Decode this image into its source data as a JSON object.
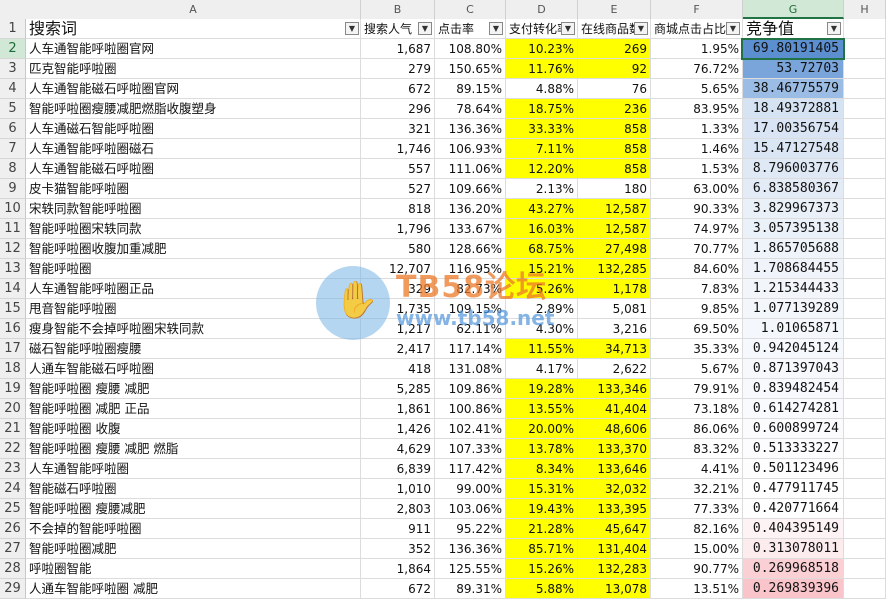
{
  "columns": [
    "A",
    "B",
    "C",
    "D",
    "E",
    "F",
    "G",
    "H"
  ],
  "header": {
    "row_number": "1",
    "keyword": "搜索词",
    "popularity": "搜索人气",
    "ctr": "点击率",
    "conversion": "支付转化率",
    "online_goods": "在线商品数",
    "mall_ctr": "商城点击占比",
    "competition": "竞争值"
  },
  "dropdown_glyph": "▼",
  "rows": [
    {
      "n": "2",
      "kw": "人车通智能呼啦圈官网",
      "pop": "1,687",
      "ctr": "108.80%",
      "conv": "10.23%",
      "goods": "269",
      "mall": "1.95%",
      "comp": "69.80191405",
      "hl": true
    },
    {
      "n": "3",
      "kw": "匹克智能呼啦圈",
      "pop": "279",
      "ctr": "150.65%",
      "conv": "11.76%",
      "goods": "92",
      "mall": "76.72%",
      "comp": "53.72703",
      "hl": true
    },
    {
      "n": "4",
      "kw": "人车通智能磁石呼啦圈官网",
      "pop": "672",
      "ctr": "89.15%",
      "conv": "4.88%",
      "goods": "76",
      "mall": "5.65%",
      "comp": "38.46775579",
      "hl": false
    },
    {
      "n": "5",
      "kw": "智能呼啦圈瘦腰减肥燃脂收腹塑身",
      "pop": "296",
      "ctr": "78.64%",
      "conv": "18.75%",
      "goods": "236",
      "mall": "83.95%",
      "comp": "18.49372881",
      "hl": true
    },
    {
      "n": "6",
      "kw": "人车通磁石智能呼啦圈",
      "pop": "321",
      "ctr": "136.36%",
      "conv": "33.33%",
      "goods": "858",
      "mall": "1.33%",
      "comp": "17.00356754",
      "hl": true
    },
    {
      "n": "7",
      "kw": "人车通智能呼啦圈磁石",
      "pop": "1,746",
      "ctr": "106.93%",
      "conv": "7.11%",
      "goods": "858",
      "mall": "1.46%",
      "comp": "15.47127548",
      "hl": true
    },
    {
      "n": "8",
      "kw": "人车通智能磁石呼啦圈",
      "pop": "557",
      "ctr": "111.06%",
      "conv": "12.20%",
      "goods": "858",
      "mall": "1.53%",
      "comp": "8.796003776",
      "hl": true
    },
    {
      "n": "9",
      "kw": "皮卡猫智能呼啦圈",
      "pop": "527",
      "ctr": "109.66%",
      "conv": "2.13%",
      "goods": "180",
      "mall": "63.00%",
      "comp": "6.838580367",
      "hl": false
    },
    {
      "n": "10",
      "kw": "宋轶同款智能呼啦圈",
      "pop": "818",
      "ctr": "136.20%",
      "conv": "43.27%",
      "goods": "12,587",
      "mall": "90.33%",
      "comp": "3.829967373",
      "hl": true
    },
    {
      "n": "11",
      "kw": "智能呼啦圈宋轶同款",
      "pop": "1,796",
      "ctr": "133.67%",
      "conv": "16.03%",
      "goods": "12,587",
      "mall": "74.97%",
      "comp": "3.057395138",
      "hl": true
    },
    {
      "n": "12",
      "kw": "智能呼啦圈收腹加重减肥",
      "pop": "580",
      "ctr": "128.66%",
      "conv": "68.75%",
      "goods": "27,498",
      "mall": "70.77%",
      "comp": "1.865705688",
      "hl": true
    },
    {
      "n": "13",
      "kw": "智能呼啦圈",
      "pop": "12,707",
      "ctr": "116.95%",
      "conv": "15.21%",
      "goods": "132,285",
      "mall": "84.60%",
      "comp": "1.708684455",
      "hl": true
    },
    {
      "n": "14",
      "kw": "人车通智能呼啦圈正品",
      "pop": "329",
      "ctr": "82.73%",
      "conv": "5.26%",
      "goods": "1,178",
      "mall": "7.83%",
      "comp": "1.215344433",
      "hl": true
    },
    {
      "n": "15",
      "kw": "甩音智能呼啦圈",
      "pop": "1,735",
      "ctr": "109.15%",
      "conv": "2.89%",
      "goods": "5,081",
      "mall": "9.85%",
      "comp": "1.077139289",
      "hl": false
    },
    {
      "n": "16",
      "kw": "瘦身智能不会掉呼啦圈宋轶同款",
      "pop": "1,217",
      "ctr": "62.11%",
      "conv": "4.30%",
      "goods": "3,216",
      "mall": "69.50%",
      "comp": "1.01065871",
      "hl": false
    },
    {
      "n": "17",
      "kw": "磁石智能呼啦圈瘦腰",
      "pop": "2,417",
      "ctr": "117.14%",
      "conv": "11.55%",
      "goods": "34,713",
      "mall": "35.33%",
      "comp": "0.942045124",
      "hl": true
    },
    {
      "n": "18",
      "kw": "人通车智能磁石呼啦圈",
      "pop": "418",
      "ctr": "131.08%",
      "conv": "4.17%",
      "goods": "2,622",
      "mall": "5.67%",
      "comp": "0.871397043",
      "hl": false
    },
    {
      "n": "19",
      "kw": "智能呼啦圈 瘦腰 减肥",
      "pop": "5,285",
      "ctr": "109.86%",
      "conv": "19.28%",
      "goods": "133,346",
      "mall": "79.91%",
      "comp": "0.839482454",
      "hl": true
    },
    {
      "n": "20",
      "kw": "智能呼啦圈 减肥 正品",
      "pop": "1,861",
      "ctr": "100.86%",
      "conv": "13.55%",
      "goods": "41,404",
      "mall": "73.18%",
      "comp": "0.614274281",
      "hl": true
    },
    {
      "n": "21",
      "kw": "智能呼啦圈 收腹",
      "pop": "1,426",
      "ctr": "102.41%",
      "conv": "20.00%",
      "goods": "48,606",
      "mall": "86.06%",
      "comp": "0.600899724",
      "hl": true
    },
    {
      "n": "22",
      "kw": "智能呼啦圈 瘦腰 减肥 燃脂",
      "pop": "4,629",
      "ctr": "107.33%",
      "conv": "13.78%",
      "goods": "133,370",
      "mall": "83.32%",
      "comp": "0.513333227",
      "hl": true
    },
    {
      "n": "23",
      "kw": "人车通智能呼啦圈",
      "pop": "6,839",
      "ctr": "117.42%",
      "conv": "8.34%",
      "goods": "133,646",
      "mall": "4.41%",
      "comp": "0.501123496",
      "hl": true
    },
    {
      "n": "24",
      "kw": "智能磁石呼啦圈",
      "pop": "1,010",
      "ctr": "99.00%",
      "conv": "15.31%",
      "goods": "32,032",
      "mall": "32.21%",
      "comp": "0.477911745",
      "hl": true
    },
    {
      "n": "25",
      "kw": "智能呼啦圈 瘦腰减肥",
      "pop": "2,803",
      "ctr": "103.06%",
      "conv": "19.43%",
      "goods": "133,395",
      "mall": "77.33%",
      "comp": "0.420771664",
      "hl": true
    },
    {
      "n": "26",
      "kw": "不会掉的智能呼啦圈",
      "pop": "911",
      "ctr": "95.22%",
      "conv": "21.28%",
      "goods": "45,647",
      "mall": "82.16%",
      "comp": "0.404395149",
      "hl": true
    },
    {
      "n": "27",
      "kw": "智能呼啦圈减肥",
      "pop": "352",
      "ctr": "136.36%",
      "conv": "85.71%",
      "goods": "131,404",
      "mall": "15.00%",
      "comp": "0.313078011",
      "hl": true
    },
    {
      "n": "28",
      "kw": "呼啦圈智能",
      "pop": "1,864",
      "ctr": "125.55%",
      "conv": "15.26%",
      "goods": "132,283",
      "mall": "90.77%",
      "comp": "0.269968518",
      "hl": true
    },
    {
      "n": "29",
      "kw": "人通车智能呼啦圈 减肥",
      "pop": "672",
      "ctr": "89.31%",
      "conv": "5.88%",
      "goods": "13,078",
      "mall": "13.51%",
      "comp": "0.269839396",
      "hl": true
    }
  ],
  "competition_colors": [
    "#5b8fd0",
    "#7aa5db",
    "#9bbde5",
    "#d6e3f3",
    "#d9e5f4",
    "#dbe6f4",
    "#dfe9f5",
    "#e3ecf6",
    "#e9f0f8",
    "#ebf1f8",
    "#eff4fa",
    "#f0f4fa",
    "#f2f6fb",
    "#f3f7fb",
    "#f4f7fb",
    "#f5f8fc",
    "#f6f8fc",
    "#f7f9fc",
    "#f9fafd",
    "#fbfbfd",
    "#fcfcfe",
    "#fdfdfe",
    "#fefefe",
    "#fefefe",
    "#fdf3f4",
    "#fcecee",
    "#fbd0d5",
    "#f9c4ca"
  ],
  "watermark": {
    "title": "TB58论坛",
    "url": "www.tb58.net",
    "icon": "hand-icon"
  },
  "colors": {
    "highlight": "#ffff00",
    "selection": "#217346",
    "header_bg": "#efefef"
  }
}
